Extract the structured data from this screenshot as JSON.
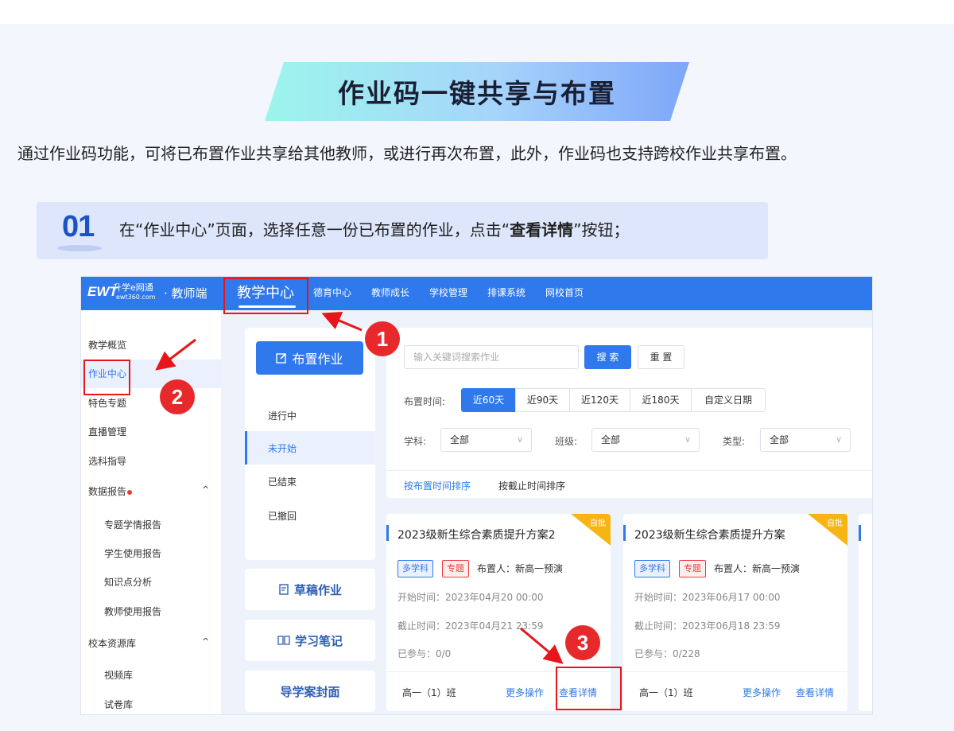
{
  "banner": {
    "title": "作业码一键共享与布置"
  },
  "intro": "通过作业码功能，可将已布置作业共享给其他教师，或进行再次布置，此外，作业码也支持跨校作业共享布置。",
  "step": {
    "number": "01",
    "text_before": "在“作业中心”页面，选择任意一份已布置的作业，点击“",
    "text_bold": "查看详情",
    "text_after": "”按钮；"
  },
  "app": {
    "logo": {
      "mark": "EWT",
      "name": "升学e网通",
      "domain": "ewt360.com"
    },
    "portal": "· 教师端",
    "nav": {
      "active": "教学中心",
      "items": [
        "德育中心",
        "教师成长",
        "学校管理",
        "排课系统",
        "网校首页"
      ]
    },
    "sidebar": {
      "items": [
        "教学概览",
        "作业中心",
        "特色专题",
        "直播管理",
        "选科指导"
      ],
      "data_report": {
        "label": "数据报告",
        "caret": "^",
        "children": [
          "专题学情报告",
          "学生使用报告",
          "知识点分析",
          "教师使用报告"
        ]
      },
      "resource": {
        "label": "校本资源库",
        "caret": "^",
        "children": [
          "视频库",
          "试卷库"
        ]
      }
    },
    "assign_button": "布置作业",
    "status_tabs": [
      "进行中",
      "未开始",
      "已结束",
      "已撤回"
    ],
    "side_cards": [
      "草稿作业",
      "学习笔记",
      "导学案封面"
    ],
    "search": {
      "placeholder": "输入关键词搜索作业",
      "search_label": "搜 索",
      "reset_label": "重 置"
    },
    "filters": {
      "time_label": "布置时间:",
      "time_options": [
        "近60天",
        "近90天",
        "近120天",
        "近180天",
        "自定义日期"
      ],
      "subject_label": "学科:",
      "subject_value": "全部",
      "class_label": "班级:",
      "class_value": "全部",
      "type_label": "类型:",
      "type_value": "全部"
    },
    "sort": {
      "by_assign": "按布置时间排序",
      "by_deadline": "按截止时间排序"
    },
    "cards": [
      {
        "title": "2023级新生综合素质提升方案2",
        "corner": "自批",
        "tags": [
          "多学科",
          "专题"
        ],
        "owner": "布置人：新高一预演",
        "start": "开始时间：2023年04月20 00:00",
        "end": "截止时间：2023年04月21 23:59",
        "joined": "已参与：0/0",
        "class": "高一（1）班",
        "more": "更多操作",
        "detail": "查看详情"
      },
      {
        "title": "2023级新生综合素质提升方案",
        "corner": "自批",
        "tags": [
          "多学科",
          "专题"
        ],
        "owner": "布置人：新高一预演",
        "start": "开始时间：2023年06月17 00:00",
        "end": "截止时间：2023年06月18 23:59",
        "joined": "已参与：0/228",
        "class": "高一（1）班",
        "more": "更多操作",
        "detail": "查看详情"
      }
    ]
  },
  "annotations": [
    "1",
    "2",
    "3"
  ],
  "colors": {
    "primary": "#2f79ec",
    "highlight": "#e8161b",
    "corner": "#f7b515"
  }
}
